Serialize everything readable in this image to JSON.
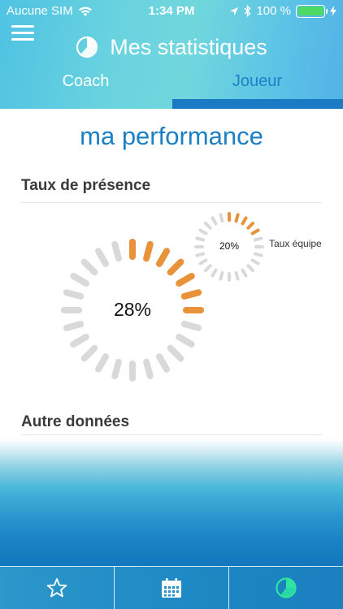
{
  "status_bar": {
    "carrier": "Aucune SIM",
    "time": "1:34 PM",
    "battery_percent": "100 %"
  },
  "header": {
    "title": "Mes statistiques",
    "tabs": [
      {
        "label": "Coach",
        "active": false
      },
      {
        "label": "Joueur",
        "active": true
      }
    ]
  },
  "main": {
    "performance_title": "ma performance",
    "presence_section_title": "Taux de présence",
    "player_rate": {
      "label": "28%",
      "value": 0.28
    },
    "team_rate": {
      "label": "20%",
      "value": 0.2,
      "caption": "Taux équipe"
    },
    "other_section_title": "Autre données"
  },
  "colors": {
    "accent": "#e8923a",
    "inactive_segment": "#d9d9d9",
    "title_blue": "#1b7fc4",
    "active_tab_icon": "#2ee5a0"
  },
  "tabbar": {
    "items": [
      {
        "icon": "star-icon",
        "active": false
      },
      {
        "icon": "calendar-icon",
        "active": false
      },
      {
        "icon": "pie-chart-icon",
        "active": true
      }
    ]
  }
}
